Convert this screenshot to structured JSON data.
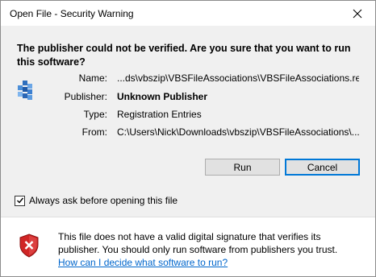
{
  "window": {
    "title": "Open File - Security Warning"
  },
  "heading": "The publisher could not be verified. Are you sure that you want to run this software?",
  "file_icon": "reg-file-icon",
  "fields": [
    {
      "label": "Name:",
      "value": "...ds\\vbszip\\VBSFileAssociations\\VBSFileAssociations.reg",
      "bold": false
    },
    {
      "label": "Publisher:",
      "value": "Unknown Publisher",
      "bold": true
    },
    {
      "label": "Type:",
      "value": "Registration Entries",
      "bold": false
    },
    {
      "label": "From:",
      "value": "C:\\Users\\Nick\\Downloads\\vbszip\\VBSFileAssociations\\...",
      "bold": false
    }
  ],
  "buttons": {
    "run": "Run",
    "cancel": "Cancel"
  },
  "checkbox": {
    "label": "Always ask before opening this file",
    "checked": true
  },
  "footer": {
    "text": "This file does not have a valid digital signature that verifies its publisher. You should only run software from publishers you trust.",
    "link": "How can I decide what software to run?"
  },
  "colors": {
    "accent": "#0078d7",
    "link": "#0066cc",
    "shield_red": "#d02525"
  }
}
